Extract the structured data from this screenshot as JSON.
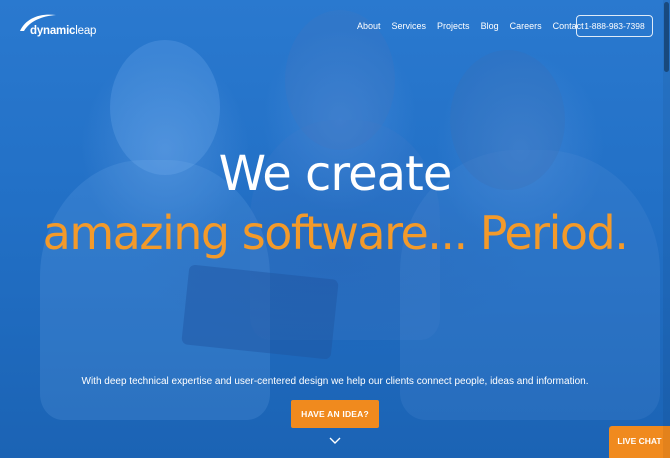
{
  "brand": {
    "logo_prefix": "dynamic",
    "logo_suffix": "leap"
  },
  "nav": {
    "items": [
      {
        "label": "About"
      },
      {
        "label": "Services"
      },
      {
        "label": "Projects"
      },
      {
        "label": "Blog"
      },
      {
        "label": "Careers"
      },
      {
        "label": "Contact"
      }
    ],
    "phone": "1-888-983-7398"
  },
  "hero": {
    "headline_line1": "We create",
    "headline_line2": "amazing software... Period.",
    "tagline": "With deep technical expertise and user-centered design we help our clients connect people, ideas and information.",
    "cta_label": "HAVE AN IDEA?",
    "scroll_icon": "chevron-down-icon"
  },
  "chat": {
    "label": "LIVE CHAT"
  },
  "colors": {
    "background": "#2270c6",
    "accent": "#f08a1e",
    "headline_accent": "#f39a2a",
    "text": "#ffffff"
  }
}
